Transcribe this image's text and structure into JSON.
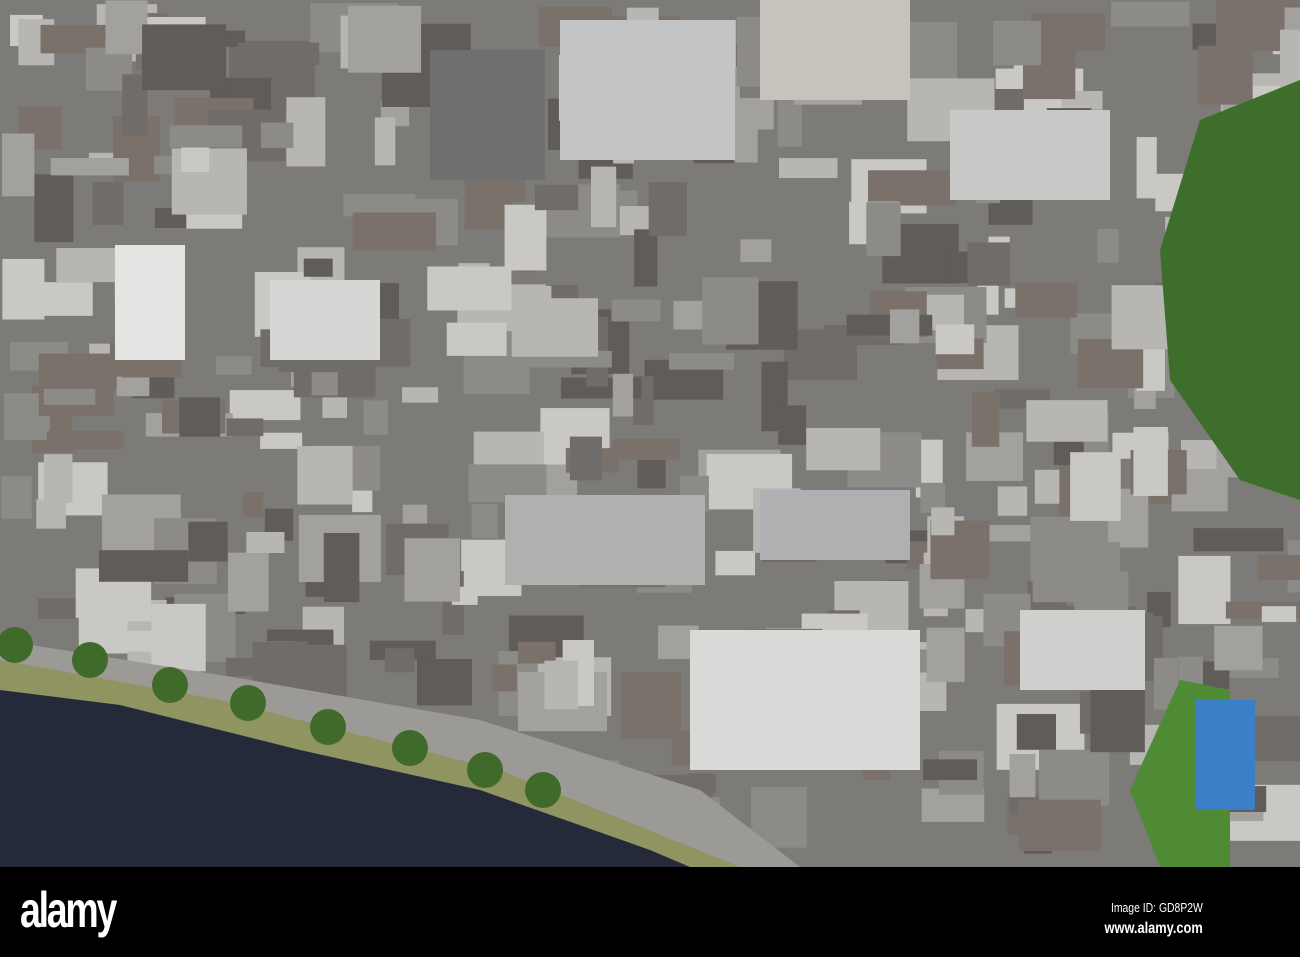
{
  "photo": {
    "subject": "aerial-city-centre-with-river"
  },
  "watermark": {
    "logo": "alamy",
    "image_id": "Image ID: GD8P2W",
    "url": "www.alamy.com"
  },
  "colors": {
    "river": "#252a3a",
    "buildings": "#8a8a88",
    "trees": "#3e6e2c",
    "bar": "#000000"
  }
}
